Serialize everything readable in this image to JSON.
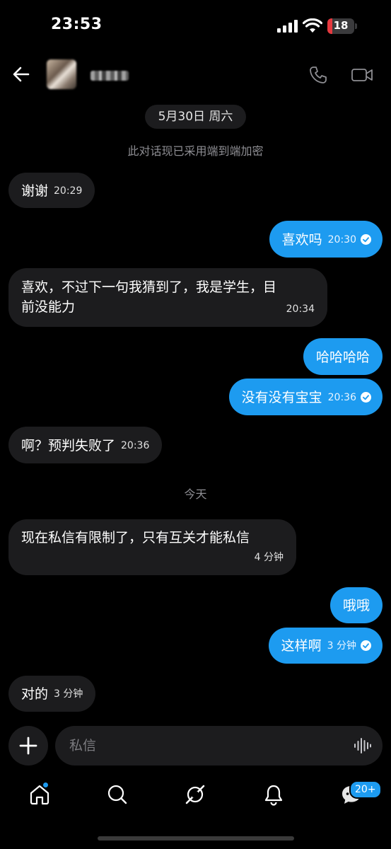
{
  "status_bar": {
    "time": "23:53",
    "battery": "18",
    "battery_level": 0.18,
    "battery_color": "#e5393f"
  },
  "header": {
    "back_icon": "arrow-left-icon",
    "call_icon": "phone-icon",
    "video_icon": "video-camera-icon"
  },
  "chat": {
    "date_chip": "5月30日 周六",
    "encryption_notice": "此对话现已采用端到端加密",
    "today_label": "今天",
    "messages": [
      {
        "direction": "in",
        "text": "谢谢",
        "time": "20:29"
      },
      {
        "direction": "out",
        "text": "喜欢吗",
        "time": "20:30",
        "read": true
      },
      {
        "direction": "in",
        "text_line1": "喜欢，不过下一句我猜到了，我是学生，目",
        "text_line2": "前没能力",
        "time": "20:34"
      },
      {
        "direction": "out",
        "text": "哈哈哈哈"
      },
      {
        "direction": "out",
        "text": "没有没有宝宝",
        "time": "20:36",
        "read": true
      },
      {
        "direction": "in",
        "text": "啊？预判失败了",
        "time": "20:36"
      },
      {
        "direction": "in",
        "text": "现在私信有限制了，只有互关才能私信",
        "time": "4 分钟"
      },
      {
        "direction": "out",
        "text": "哦哦"
      },
      {
        "direction": "out",
        "text": "这样啊",
        "time": "3 分钟",
        "read": true
      },
      {
        "direction": "in",
        "text": "对的",
        "time": "3 分钟"
      }
    ]
  },
  "composer": {
    "plus_icon": "plus-icon",
    "placeholder": "私信",
    "voice_icon": "voice-waveform-icon"
  },
  "bottom_nav": {
    "items": [
      "home-icon",
      "search-icon",
      "grok-icon",
      "bell-icon",
      "messages-icon"
    ],
    "messages_badge": "20+"
  },
  "colors": {
    "accent": "#1d9bf0",
    "incoming_bubble": "#1c1c1e",
    "background": "#000000"
  }
}
